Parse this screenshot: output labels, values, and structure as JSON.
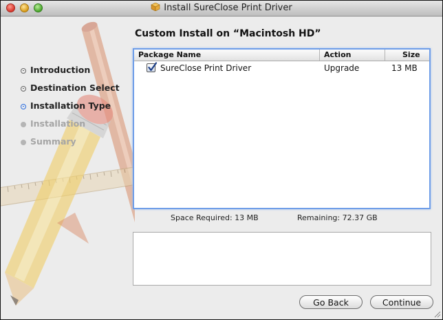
{
  "window": {
    "title": "Install SureClose Print Driver",
    "heading": "Custom Install on “Macintosh HD”"
  },
  "steps": [
    {
      "label": "Introduction",
      "state": "done"
    },
    {
      "label": "Destination Select",
      "state": "done"
    },
    {
      "label": "Installation Type",
      "state": "current"
    },
    {
      "label": "Installation",
      "state": "pending"
    },
    {
      "label": "Summary",
      "state": "pending"
    }
  ],
  "table": {
    "columns": [
      "Package Name",
      "Action",
      "Size"
    ],
    "rows": [
      {
        "checked": true,
        "name": "SureClose Print Driver",
        "action": "Upgrade",
        "size": "13 MB"
      }
    ]
  },
  "space": {
    "required": "Space Required:  13 MB",
    "remaining": "Remaining:  72.37 GB"
  },
  "buttons": {
    "back": "Go Back",
    "continue": "Continue"
  },
  "colors": {
    "accent": "#2a6ce0",
    "selection_border": "#6f9ee8"
  },
  "icons": {
    "title_icon": "package-icon",
    "background_art": "pencil-ruler-icon"
  }
}
